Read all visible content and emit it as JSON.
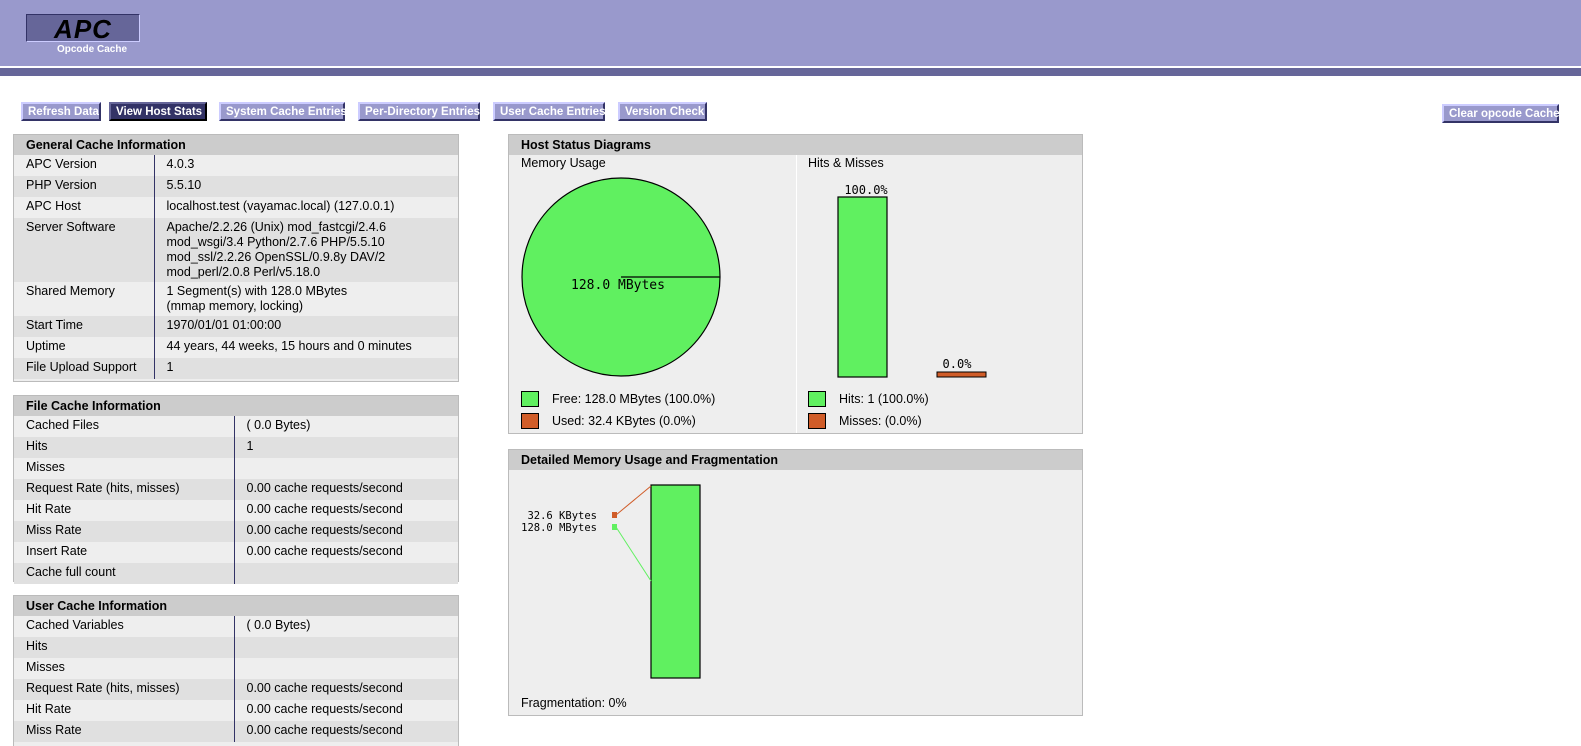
{
  "header": {
    "logo": "APC",
    "subtitle": "Opcode Cache"
  },
  "menu": {
    "refresh": "Refresh Data",
    "host_stats": "View Host Stats",
    "system_cache": "System Cache Entries",
    "per_directory": "Per-Directory Entries",
    "user_cache": "User Cache Entries",
    "version_check": "Version Check",
    "clear": "Clear opcode Cache"
  },
  "general": {
    "title": "General Cache Information",
    "rows": [
      {
        "k": "APC Version",
        "v": "4.0.3"
      },
      {
        "k": "PHP Version",
        "v": "5.5.10"
      },
      {
        "k": "APC Host",
        "v": "localhost.test (vayamac.local) (127.0.0.1)"
      },
      {
        "k": "Server Software",
        "v1": "Apache/2.2.26 (Unix) mod_fastcgi/2.4.6",
        "v2": "mod_wsgi/3.4 Python/2.7.6 PHP/5.5.10",
        "v3": "mod_ssl/2.2.26 OpenSSL/0.9.8y DAV/2",
        "v4": "mod_perl/2.0.8 Perl/v5.18.0"
      },
      {
        "k": "Shared Memory",
        "v1": "1 Segment(s) with 128.0 MBytes",
        "v2": "(mmap memory, locking)"
      },
      {
        "k": "Start Time",
        "v": "1970/01/01 01:00:00"
      },
      {
        "k": "Uptime",
        "v": "44 years, 44 weeks, 15 hours and 0 minutes"
      },
      {
        "k": "File Upload Support",
        "v": "1"
      }
    ]
  },
  "file_cache": {
    "title": "File Cache Information",
    "rows": [
      {
        "k": "Cached Files",
        "v": "( 0.0 Bytes)"
      },
      {
        "k": "Hits",
        "v": "1"
      },
      {
        "k": "Misses",
        "v": ""
      },
      {
        "k": "Request Rate (hits, misses)",
        "v": "0.00 cache requests/second"
      },
      {
        "k": "Hit Rate",
        "v": "0.00 cache requests/second"
      },
      {
        "k": "Miss Rate",
        "v": "0.00 cache requests/second"
      },
      {
        "k": "Insert Rate",
        "v": "0.00 cache requests/second"
      },
      {
        "k": "Cache full count",
        "v": ""
      }
    ]
  },
  "user_cache": {
    "title": "User Cache Information",
    "rows": [
      {
        "k": "Cached Variables",
        "v": "( 0.0 Bytes)"
      },
      {
        "k": "Hits",
        "v": ""
      },
      {
        "k": "Misses",
        "v": ""
      },
      {
        "k": "Request Rate (hits, misses)",
        "v": "0.00 cache requests/second"
      },
      {
        "k": "Hit Rate",
        "v": "0.00 cache requests/second"
      },
      {
        "k": "Miss Rate",
        "v": "0.00 cache requests/second"
      }
    ]
  },
  "host_status": {
    "title": "Host Status Diagrams",
    "memory_title": "Memory Usage",
    "hits_title": "Hits & Misses",
    "pie_label": "128.0 MBytes",
    "hits_pct": "100.0%",
    "misses_pct": "0.0%",
    "hits_fraction": 1.0,
    "misses_fraction": 0.0,
    "free_fraction": 1.0,
    "legend_free": "Free: 128.0 MBytes (100.0%)",
    "legend_used": "Used: 32.4 KBytes (0.0%)",
    "legend_hits": "Hits: 1 (100.0%)",
    "legend_misses": "Misses: (0.0%)"
  },
  "detailed": {
    "title": "Detailed Memory Usage and Fragmentation",
    "label_used": "32.6 KBytes",
    "label_free": "128.0 MBytes",
    "fragmentation": "Fragmentation: 0%"
  },
  "colors": {
    "green": "#60f060",
    "orange": "#d05c28",
    "header": "#9999cc",
    "header_dark": "#666699"
  }
}
